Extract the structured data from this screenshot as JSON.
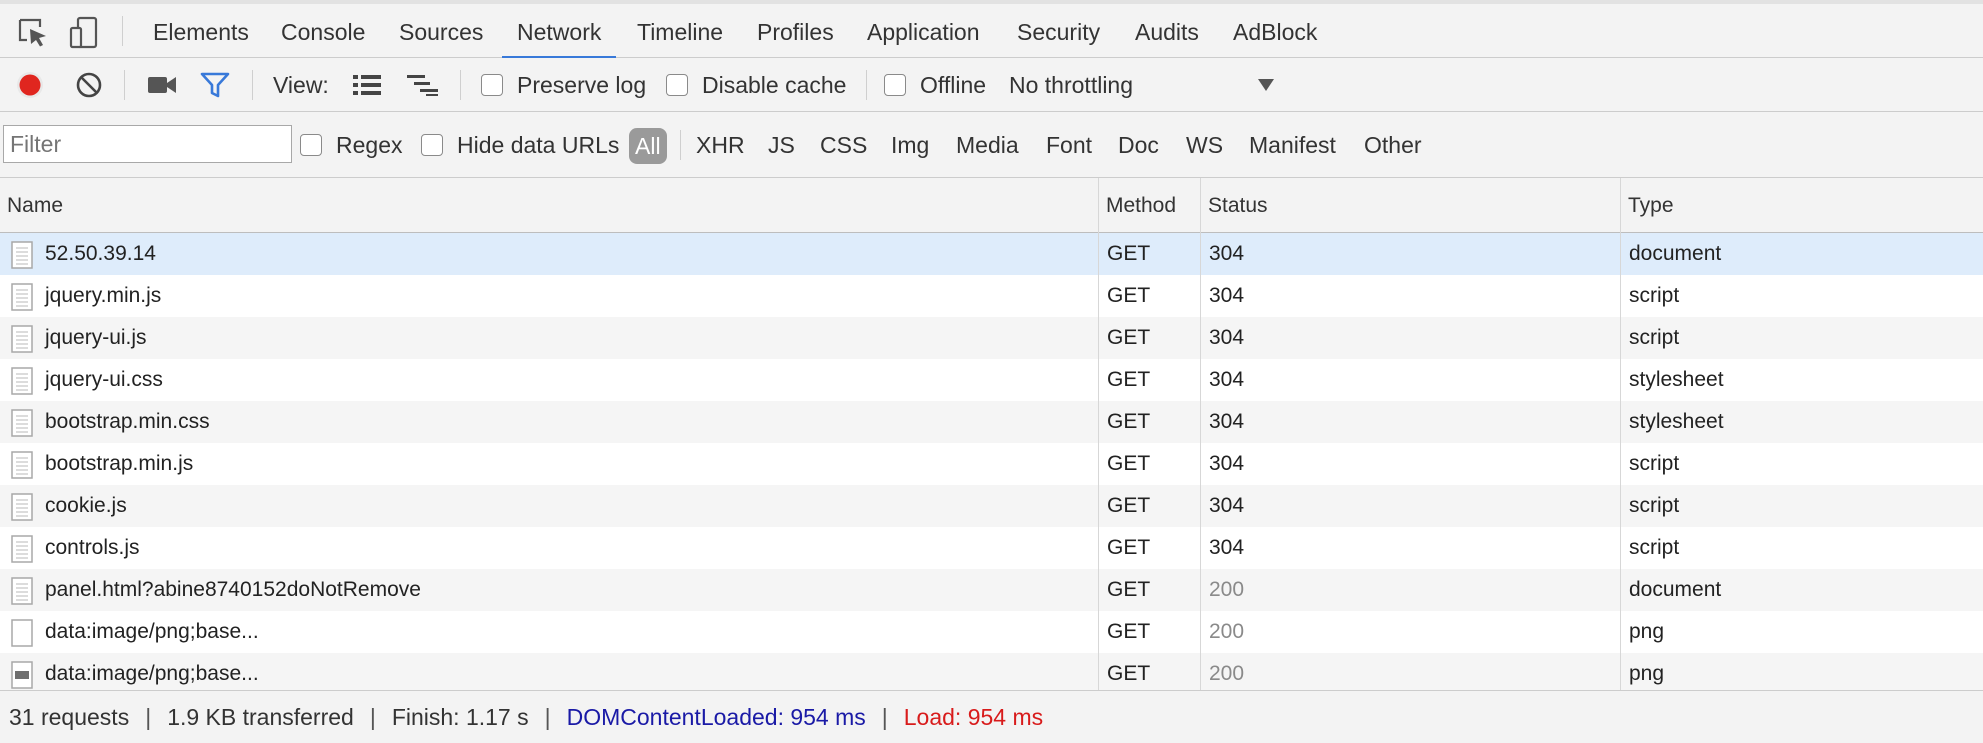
{
  "tabs": [
    {
      "id": "elements",
      "label": "Elements",
      "active": false
    },
    {
      "id": "console",
      "label": "Console",
      "active": false
    },
    {
      "id": "sources",
      "label": "Sources",
      "active": false
    },
    {
      "id": "network",
      "label": "Network",
      "active": true
    },
    {
      "id": "timeline",
      "label": "Timeline",
      "active": false
    },
    {
      "id": "profiles",
      "label": "Profiles",
      "active": false
    },
    {
      "id": "application",
      "label": "Application",
      "active": false
    },
    {
      "id": "security",
      "label": "Security",
      "active": false
    },
    {
      "id": "audits",
      "label": "Audits",
      "active": false
    },
    {
      "id": "adblock",
      "label": "AdBlock",
      "active": false
    }
  ],
  "toolbar": {
    "view_label": "View:",
    "preserve_log": "Preserve log",
    "disable_cache": "Disable cache",
    "offline": "Offline",
    "throttling": "No throttling"
  },
  "filter": {
    "placeholder": "Filter",
    "regex": "Regex",
    "hide_data_urls": "Hide data URLs",
    "types": [
      "All",
      "XHR",
      "JS",
      "CSS",
      "Img",
      "Media",
      "Font",
      "Doc",
      "WS",
      "Manifest",
      "Other"
    ],
    "active_type": "All"
  },
  "columns": {
    "name": "Name",
    "method": "Method",
    "status": "Status",
    "type": "Type"
  },
  "rows": [
    {
      "name": "52.50.39.14",
      "method": "GET",
      "status": "304",
      "type": "document",
      "selected": true
    },
    {
      "name": "jquery.min.js",
      "method": "GET",
      "status": "304",
      "type": "script"
    },
    {
      "name": "jquery-ui.js",
      "method": "GET",
      "status": "304",
      "type": "script"
    },
    {
      "name": "jquery-ui.css",
      "method": "GET",
      "status": "304",
      "type": "stylesheet"
    },
    {
      "name": "bootstrap.min.css",
      "method": "GET",
      "status": "304",
      "type": "stylesheet"
    },
    {
      "name": "bootstrap.min.js",
      "method": "GET",
      "status": "304",
      "type": "script"
    },
    {
      "name": "cookie.js",
      "method": "GET",
      "status": "304",
      "type": "script"
    },
    {
      "name": "controls.js",
      "method": "GET",
      "status": "304",
      "type": "script"
    },
    {
      "name": "panel.html?abine8740152doNotRemove",
      "method": "GET",
      "status": "200",
      "type": "document"
    },
    {
      "name": "data:image/png;base...",
      "method": "GET",
      "status": "200",
      "type": "png"
    },
    {
      "name": "data:image/png;base...",
      "method": "GET",
      "status": "200",
      "type": "png"
    }
  ],
  "status": {
    "requests": "31 requests",
    "transferred": "1.9 KB transferred",
    "finish": "Finish: 1.17 s",
    "dom_content_loaded": "DOMContentLoaded: 954 ms",
    "load": "Load: 954 ms"
  },
  "colors": {
    "record": "#e0261f",
    "accent": "#3879d9",
    "selected_row": "#deecfb",
    "dcl": "#1a1aa6",
    "load": "#d81b1b"
  }
}
